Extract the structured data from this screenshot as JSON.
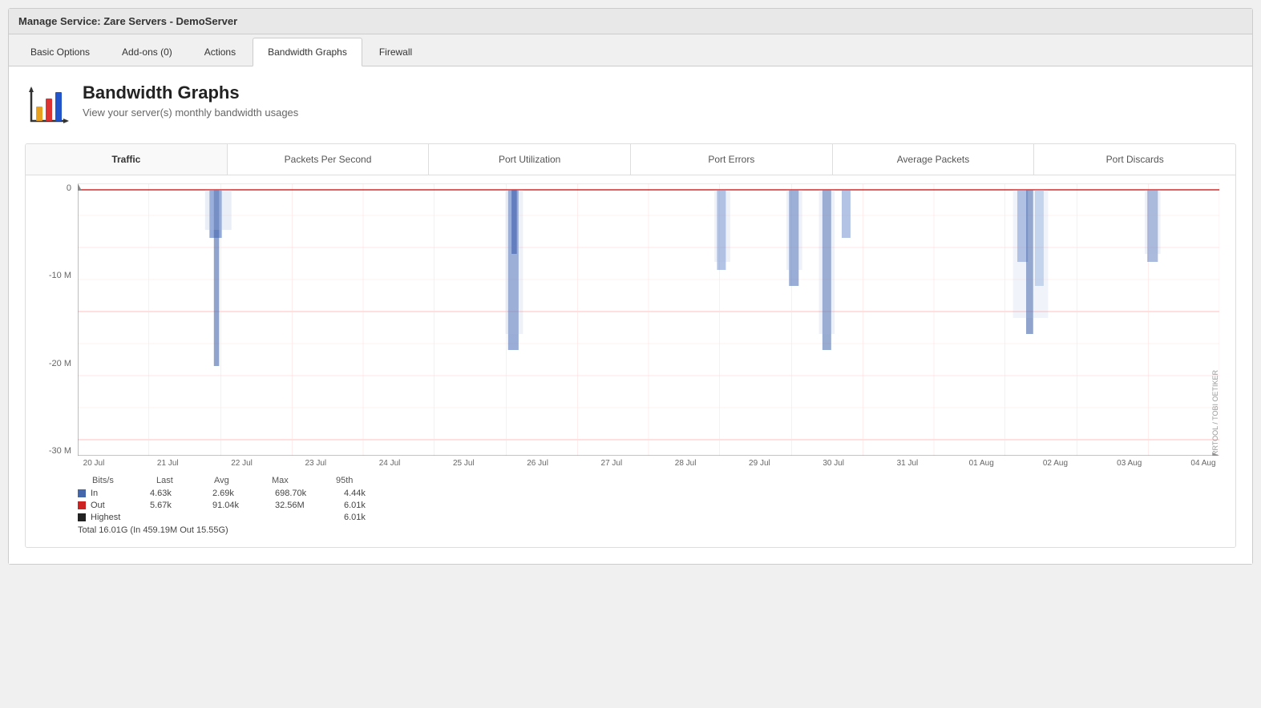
{
  "window": {
    "title": "Manage Service: Zare Servers - DemoServer"
  },
  "tabs": [
    {
      "id": "basic-options",
      "label": "Basic Options",
      "active": false
    },
    {
      "id": "add-ons",
      "label": "Add-ons (0)",
      "active": false
    },
    {
      "id": "actions",
      "label": "Actions",
      "active": false
    },
    {
      "id": "bandwidth-graphs",
      "label": "Bandwidth Graphs",
      "active": true
    },
    {
      "id": "firewall",
      "label": "Firewall",
      "active": false
    }
  ],
  "page": {
    "heading": "Bandwidth Graphs",
    "subheading": "View your server(s) monthly bandwidth usages"
  },
  "chart": {
    "tabs": [
      {
        "id": "traffic",
        "label": "Traffic",
        "active": true
      },
      {
        "id": "pps",
        "label": "Packets Per Second",
        "active": false
      },
      {
        "id": "port-util",
        "label": "Port Utilization",
        "active": false
      },
      {
        "id": "port-errors",
        "label": "Port Errors",
        "active": false
      },
      {
        "id": "avg-packets",
        "label": "Average Packets",
        "active": false
      },
      {
        "id": "port-discards",
        "label": "Port Discards",
        "active": false
      }
    ],
    "y_labels": [
      "0",
      "-10 M",
      "-20 M",
      "-30 M"
    ],
    "x_labels": [
      "20 Jul",
      "21 Jul",
      "22 Jul",
      "23 Jul",
      "24 Jul",
      "25 Jul",
      "26 Jul",
      "27 Jul",
      "28 Jul",
      "29 Jul",
      "30 Jul",
      "31 Jul",
      "01 Aug",
      "02 Aug",
      "03 Aug",
      "04 Aug"
    ],
    "rotated_label": "RRTOOL / TOBI OETIKER",
    "legend": {
      "headers": [
        "Bits/s",
        "Last",
        "Avg",
        "Max",
        "95th"
      ],
      "rows": [
        {
          "label": "In",
          "color": "#4444bb",
          "last": "4.63k",
          "avg": "2.69k",
          "max": "698.70k",
          "p95": "4.44k"
        },
        {
          "label": "Out",
          "color": "#cc2222",
          "last": "5.67k",
          "avg": "91.04k",
          "max": "32.56M",
          "p95": "6.01k"
        },
        {
          "label": "Highest",
          "color": "#222222",
          "last": "",
          "avg": "",
          "max": "",
          "p95": "6.01k"
        }
      ],
      "total": "Total  16.01G    (In 459.19M   Out  15.55G)"
    }
  }
}
